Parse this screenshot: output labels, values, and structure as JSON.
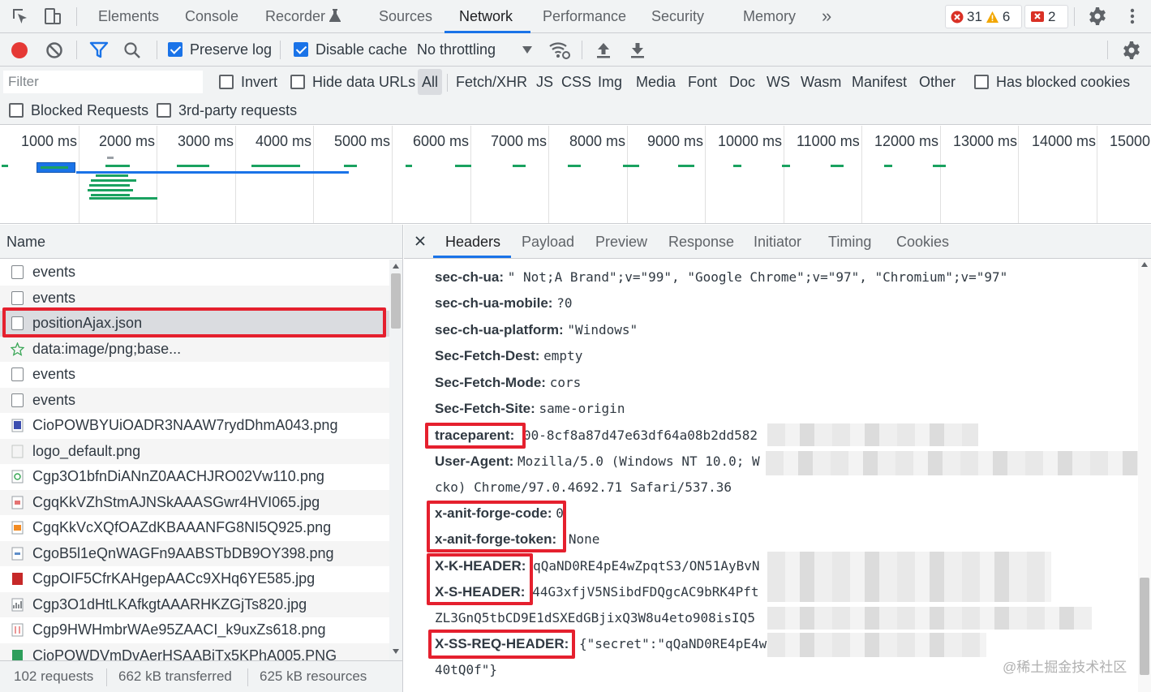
{
  "topbar": {
    "tabs": [
      "Elements",
      "Console",
      "Recorder",
      "Sources",
      "Network",
      "Performance",
      "Security",
      "Memory"
    ],
    "more": "»",
    "errors": "31",
    "warnings": "6",
    "issues": "2"
  },
  "toolbar": {
    "preserve_log": "Preserve log",
    "disable_cache": "Disable cache",
    "throttling": "No throttling"
  },
  "filter": {
    "placeholder": "Filter",
    "invert": "Invert",
    "hide_data_urls": "Hide data URLs",
    "types": [
      "All",
      "Fetch/XHR",
      "JS",
      "CSS",
      "Img",
      "Media",
      "Font",
      "Doc",
      "WS",
      "Wasm",
      "Manifest",
      "Other"
    ],
    "has_blocked_cookies": "Has blocked cookies",
    "blocked_requests": "Blocked Requests",
    "third_party": "3rd-party requests"
  },
  "overview": {
    "ticks": [
      "1000 ms",
      "2000 ms",
      "3000 ms",
      "4000 ms",
      "5000 ms",
      "6000 ms",
      "7000 ms",
      "8000 ms",
      "9000 ms",
      "10000 ms",
      "11000 ms",
      "12000 ms",
      "13000 ms",
      "14000 ms",
      "15000"
    ]
  },
  "list": {
    "header": "Name",
    "rows": [
      "events",
      "events",
      "positionAjax.json",
      "data:image/png;base...",
      "events",
      "events",
      "CioPOWBYUiOADR3NAAW7rydDhmA043.png",
      "logo_default.png",
      "Cgp3O1bfnDiANnZ0AACHJRO02Vw110.png",
      "CgqKkVZhStmAJNSkAAASGwr4HVI065.jpg",
      "CgqKkVcXQfOAZdKBAAANFG8NI5Q925.png",
      "CgoB5l1eQnWAGFn9AABSTbDB9OY398.png",
      "CgpOIF5CfrKAHgepAACc9XHq6YE585.jpg",
      "Cgp3O1dHtLKAfkgtAAARHKZGjTs820.jpg",
      "Cgp9HWHmbrWAe95ZAACI_k9uxZs618.png",
      "CioPOWDVmDvAerHSAABiTx5KPhA005.PNG"
    ],
    "status": {
      "requests": "102 requests",
      "transferred": "662 kB transferred",
      "resources": "625 kB resources"
    }
  },
  "details": {
    "tabs": [
      "Headers",
      "Payload",
      "Preview",
      "Response",
      "Initiator",
      "Timing",
      "Cookies"
    ],
    "headers": [
      {
        "key": "sec-ch-ua:",
        "value": "\" Not;A Brand\";v=\"99\", \"Google Chrome\";v=\"97\", \"Chromium\";v=\"97\""
      },
      {
        "key": "sec-ch-ua-mobile:",
        "value": "?0"
      },
      {
        "key": "sec-ch-ua-platform:",
        "value": "\"Windows\""
      },
      {
        "key": "Sec-Fetch-Dest:",
        "value": "empty"
      },
      {
        "key": "Sec-Fetch-Mode:",
        "value": "cors"
      },
      {
        "key": "Sec-Fetch-Site:",
        "value": "same-origin"
      },
      {
        "key": "traceparent:",
        "value": "00-8cf8a87d47e63df64a08b2dd582"
      },
      {
        "key": "User-Agent:",
        "value": "Mozilla/5.0 (Windows NT 10.0; W"
      },
      {
        "key": "",
        "value": "cko) Chrome/97.0.4692.71 Safari/537.36"
      },
      {
        "key": "x-anit-forge-code:",
        "value": "0"
      },
      {
        "key": "x-anit-forge-token:",
        "value": "None"
      },
      {
        "key": "X-K-HEADER:",
        "value": "qQaND0RE4pE4wZpqtS3/ON51AyBvN"
      },
      {
        "key": "X-S-HEADER:",
        "value": "44G3xfjV5NSibdFDQgcAC9bRK4Pft"
      },
      {
        "key": "",
        "value": "ZL3GnQ5tbCD9E1dSXEdGBjixQ3W8u4eto908isIQ5"
      },
      {
        "key": "X-SS-REQ-HEADER:",
        "value": "{\"secret\":\"qQaND0RE4pE4w"
      },
      {
        "key": "",
        "value": "40tQ0f\"}"
      }
    ]
  },
  "watermark": "@稀土掘金技术社区",
  "colors": {
    "accent": "#1a73e8",
    "highlight_box": "#e5202e",
    "record": "#e53935"
  }
}
